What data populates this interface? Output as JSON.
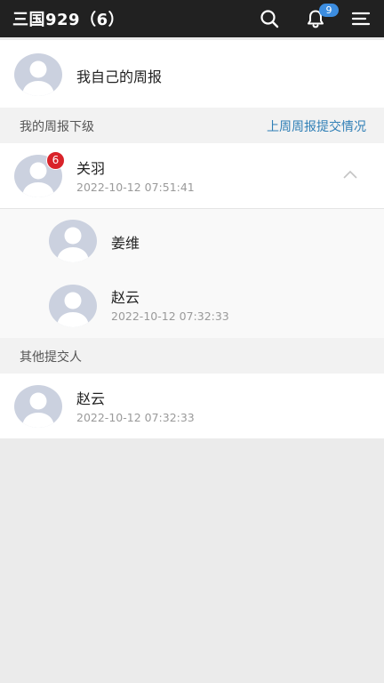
{
  "header": {
    "title": "三国929（6）",
    "notification_count": "9",
    "icons": [
      "search-icon",
      "bell-icon",
      "menu-icon"
    ]
  },
  "self_report": {
    "label": "我自己的周报"
  },
  "subordinates": {
    "section_title": "我的周报下级",
    "link_label": "上周周报提交情况",
    "group": {
      "name": "关羽",
      "time": "2022-10-12 07:51:41",
      "unread": "6",
      "expanded": true,
      "members": [
        {
          "name": "姜维",
          "time": ""
        },
        {
          "name": "赵云",
          "time": "2022-10-12 07:32:33"
        }
      ]
    }
  },
  "others": {
    "section_title": "其他提交人",
    "items": [
      {
        "name": "赵云",
        "time": "2022-10-12 07:32:33"
      }
    ]
  },
  "colors": {
    "header_bg": "#212121",
    "link": "#2f7fb6",
    "badge_red": "#d9232a",
    "badge_blue": "#3c8de0",
    "avatar": "#cbd1df"
  }
}
